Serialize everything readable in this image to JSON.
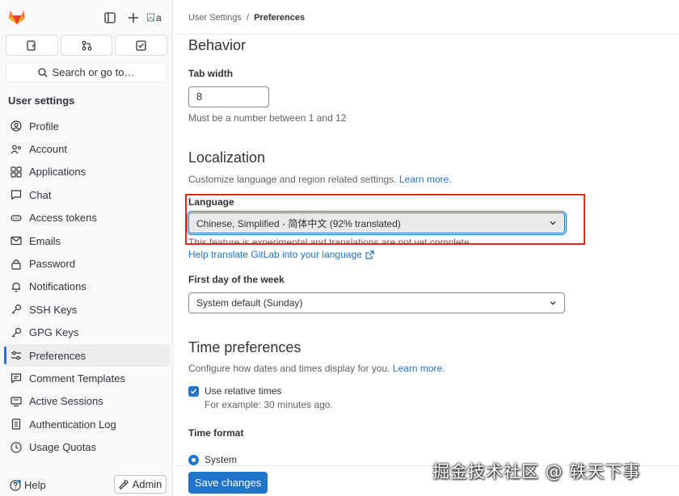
{
  "sidebar": {
    "avatar_text": "a",
    "search_label": "Search or go to…",
    "heading": "User settings",
    "items": [
      {
        "label": "Profile",
        "icon": "profile-icon"
      },
      {
        "label": "Account",
        "icon": "account-icon"
      },
      {
        "label": "Applications",
        "icon": "applications-icon"
      },
      {
        "label": "Chat",
        "icon": "chat-icon"
      },
      {
        "label": "Access tokens",
        "icon": "token-icon"
      },
      {
        "label": "Emails",
        "icon": "email-icon"
      },
      {
        "label": "Password",
        "icon": "lock-icon"
      },
      {
        "label": "Notifications",
        "icon": "bell-icon"
      },
      {
        "label": "SSH Keys",
        "icon": "key-icon"
      },
      {
        "label": "GPG Keys",
        "icon": "key-icon"
      },
      {
        "label": "Preferences",
        "icon": "preferences-icon",
        "active": true
      },
      {
        "label": "Comment Templates",
        "icon": "comment-icon"
      },
      {
        "label": "Active Sessions",
        "icon": "monitor-icon"
      },
      {
        "label": "Authentication Log",
        "icon": "log-icon"
      },
      {
        "label": "Usage Quotas",
        "icon": "quota-icon"
      }
    ],
    "help_label": "Help",
    "admin_label": "Admin"
  },
  "breadcrumb": {
    "parent": "User Settings",
    "separator": "/",
    "current": "Preferences"
  },
  "behavior": {
    "title": "Behavior",
    "tab_width_label": "Tab width",
    "tab_width_value": "8",
    "tab_width_help": "Must be a number between 1 and 12"
  },
  "localization": {
    "title": "Localization",
    "description": "Customize language and region related settings.",
    "learn_more": "Learn more.",
    "language_label": "Language",
    "language_value": "Chinese, Simplified - 简体中文 (92% translated)",
    "language_help": "This feature is experimental and translations are not yet complete.",
    "help_translate": "Help translate GitLab into your language",
    "first_day_label": "First day of the week",
    "first_day_value": "System default (Sunday)"
  },
  "time_preferences": {
    "title": "Time preferences",
    "description": "Configure how dates and times display for you.",
    "learn_more": "Learn more.",
    "relative_label": "Use relative times",
    "relative_checked": true,
    "relative_help": "For example: 30 minutes ago.",
    "format_label": "Time format",
    "format_option": "System"
  },
  "save_label": "Save changes",
  "watermark": "掘金技术社区 @ 轶天下事",
  "colors": {
    "accent": "#1f75cb",
    "highlight": "#e0281d",
    "logo": "#fc6d26"
  }
}
